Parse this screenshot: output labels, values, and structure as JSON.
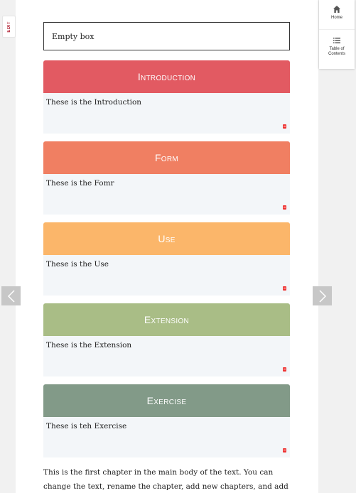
{
  "edit_tab": {
    "label": "EDIT"
  },
  "empty_box": {
    "text": "Empty box"
  },
  "sections": [
    {
      "title": "Introduction",
      "body": "These is the Introduction",
      "color": "#e25a62"
    },
    {
      "title": "Form",
      "body": "These is the Fomr",
      "color": "#f07f62"
    },
    {
      "title": "Use",
      "body": "These is the Use",
      "color": "#fbb66a"
    },
    {
      "title": "Extension",
      "body": "These is the Extension",
      "color": "#a9bd86"
    },
    {
      "title": "Exercise",
      "body": "These is teh Exercise",
      "color": "#829a88"
    }
  ],
  "body_paragraph": "This is the first chapter in the main body of the text. You can change the text, rename the chapter, add new chapters, and add new parts.",
  "sidebar": {
    "home_label": "Home",
    "toc_label": "Table of Contents"
  },
  "colors": {
    "page_bg": "#f1f1f1",
    "section_body_bg": "#f3f6f9",
    "nav_arrow_bg": "#c7c7c7"
  },
  "icons": [
    "home-icon",
    "list-icon",
    "prev-arrow-icon",
    "next-arrow-icon"
  ]
}
